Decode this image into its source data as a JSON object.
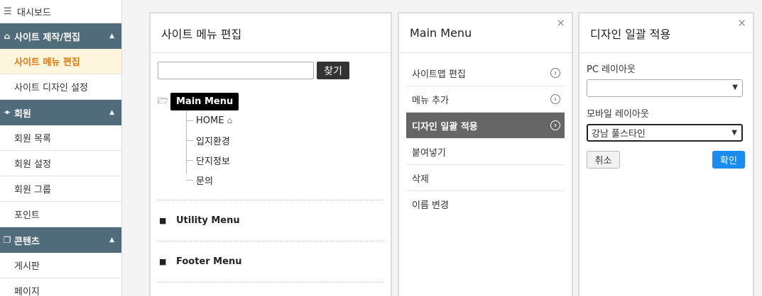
{
  "sidebar": {
    "dashboard": "대시보드",
    "groups": [
      {
        "label": "사이트 제작/편집",
        "items": [
          "사이트 메뉴 편집",
          "사이트 디자인 설정"
        ]
      },
      {
        "label": "회원",
        "items": [
          "회원 목록",
          "회원 설정",
          "회원 그룹",
          "포인트"
        ]
      },
      {
        "label": "콘텐츠",
        "items": [
          "게시판",
          "페이지"
        ]
      }
    ]
  },
  "menu_editor": {
    "title": "사이트 메뉴 편집",
    "search_value": "",
    "find_button": "찾기",
    "root_menu": "Main Menu",
    "children": [
      "HOME",
      "입지환경",
      "단지정보",
      "문의"
    ],
    "other_menus": [
      "Utility Menu",
      "Footer Menu"
    ]
  },
  "action_panel": {
    "title": "Main Menu",
    "actions": [
      "사이트맵 편집",
      "메뉴 추가",
      "디자인 일괄 적용",
      "붙여넣기",
      "삭제",
      "이름 변경"
    ]
  },
  "design_panel": {
    "title": "디자인 일괄 적용",
    "pc_label": "PC 레이아웃",
    "pc_value": "",
    "mobile_label": "모바일 레이아웃",
    "mobile_value": "강남 풀스타인",
    "cancel": "취소",
    "confirm": "확인"
  },
  "colors": {
    "sidebar_group": "#506b79",
    "active_item_text": "#e07a10",
    "selected_action": "#666666",
    "confirm_button": "#1a8cf0"
  }
}
